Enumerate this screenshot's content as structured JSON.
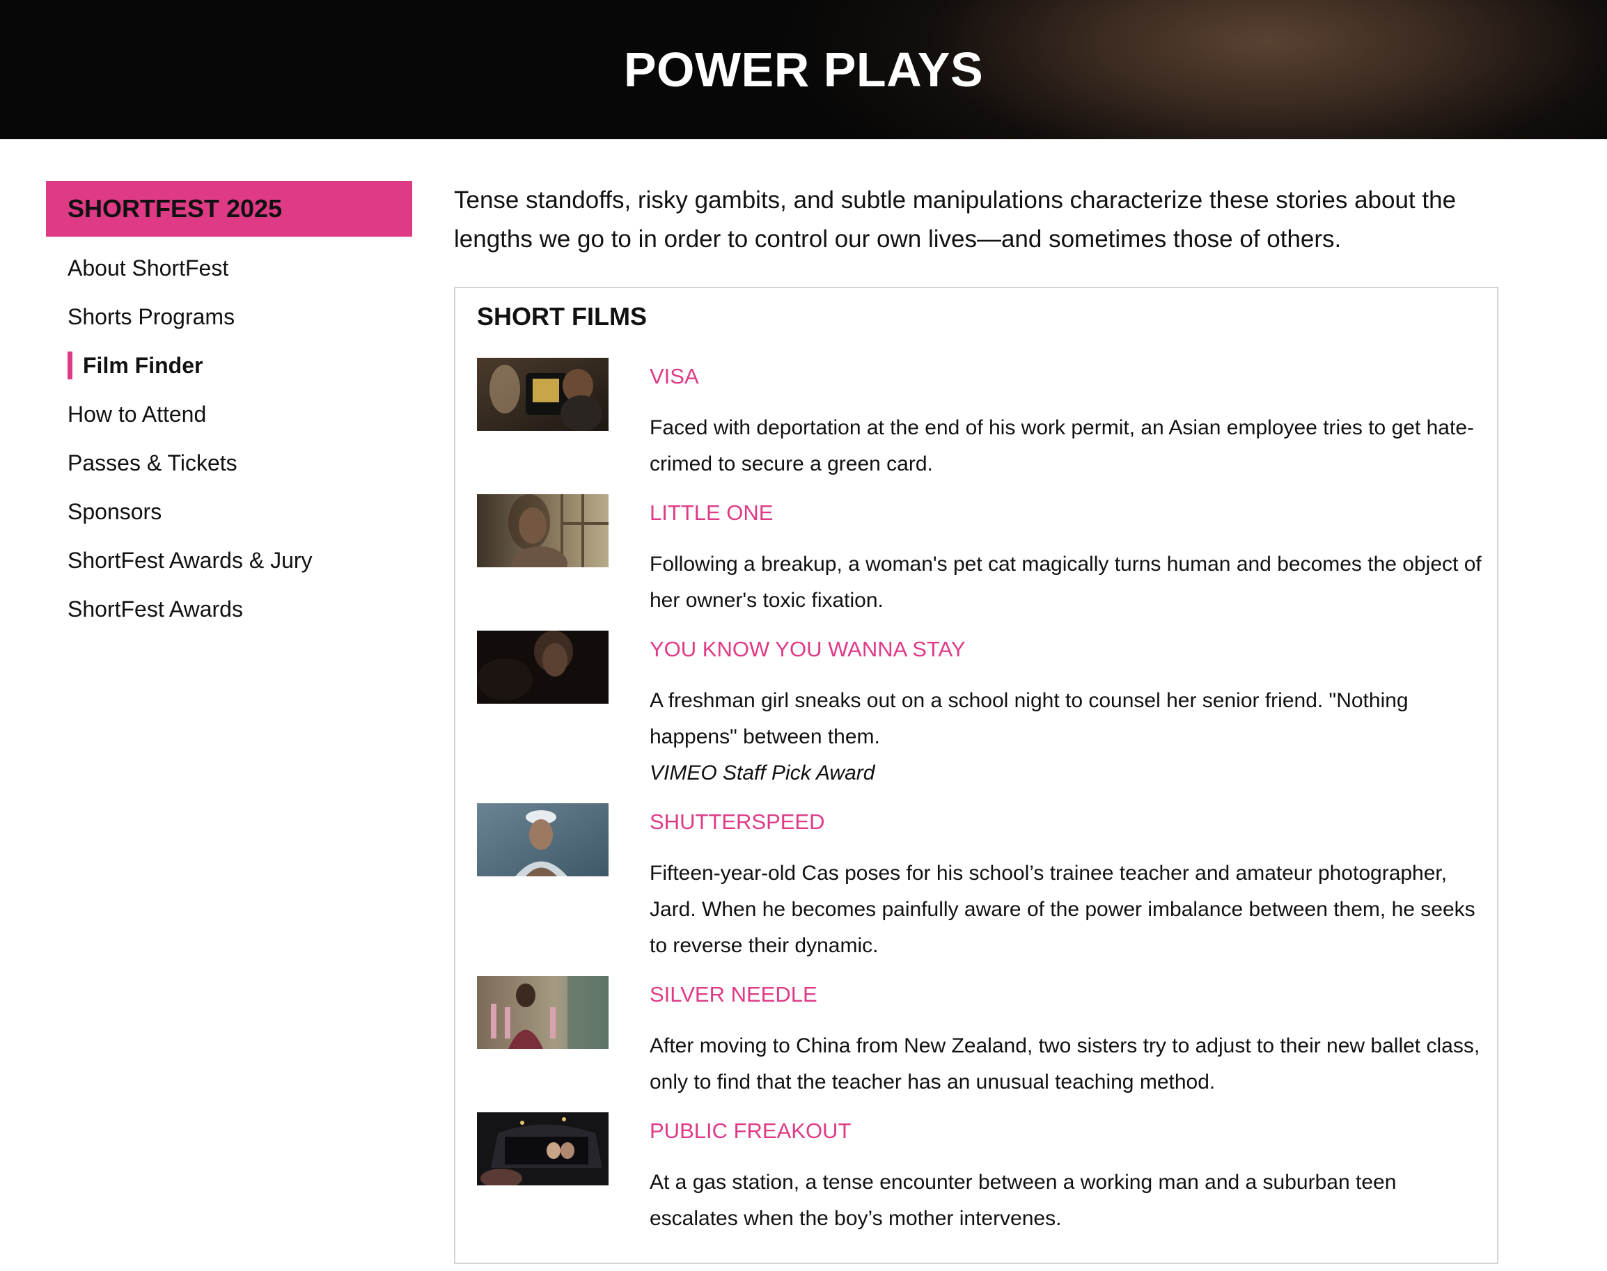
{
  "header": {
    "title": "POWER PLAYS"
  },
  "sidebar": {
    "heading": "SHORTFEST 2025",
    "items": [
      {
        "label": "About ShortFest"
      },
      {
        "label": "Shorts Programs"
      },
      {
        "label": "Film Finder",
        "active": true
      },
      {
        "label": "How to Attend"
      },
      {
        "label": "Passes & Tickets"
      },
      {
        "label": "Sponsors"
      },
      {
        "label": "ShortFest Awards & Jury"
      },
      {
        "label": "ShortFest Awards"
      }
    ]
  },
  "main": {
    "intro": "Tense standoffs, risky gambits, and subtle manipulations characterize these stories about the lengths we go to in order to control our own lives—and sometimes those of others.",
    "section_title": "SHORT FILMS",
    "films": [
      {
        "title": "VISA",
        "description": "Faced with deportation at the end of his work permit, an Asian employee tries to get hate-crimed to secure a green card."
      },
      {
        "title": "LITTLE ONE",
        "description": "Following a breakup, a woman's pet cat magically turns human and becomes the object of her owner's toxic fixation."
      },
      {
        "title": "YOU KNOW YOU WANNA STAY",
        "description": "A freshman girl sneaks out on a school night to counsel her senior friend. \"Nothing happens\" between them.",
        "award": "VIMEO Staff Pick Award"
      },
      {
        "title": "SHUTTERSPEED",
        "description": "Fifteen-year-old Cas poses for his school’s trainee teacher and amateur photographer, Jard. When he becomes painfully aware of the power imbalance between them, he seeks to reverse their dynamic."
      },
      {
        "title": "SILVER NEEDLE",
        "description": "After moving to China from New Zealand, two sisters try to adjust to their new ballet class, only to find that the teacher has an unusual teaching method."
      },
      {
        "title": "PUBLIC FREAKOUT",
        "description": "At a gas station, a tense encounter between a working man and a suburban teen escalates when the boy’s mother intervenes."
      }
    ]
  },
  "colors": {
    "accent": "#df3a86",
    "text": "#111111",
    "border": "#d4d4d4"
  }
}
